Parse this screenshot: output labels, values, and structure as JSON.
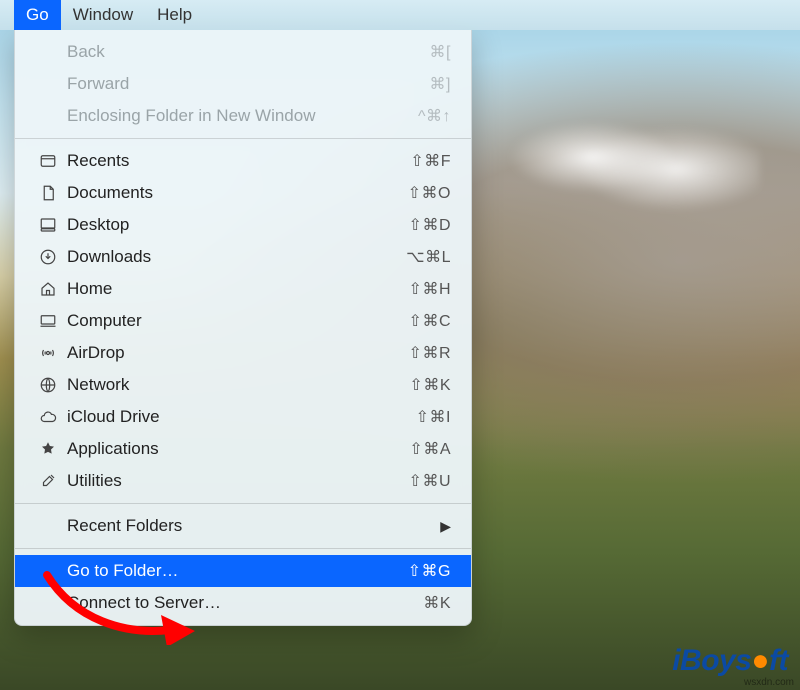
{
  "menubar": {
    "items": [
      {
        "label": "Go",
        "active": true
      },
      {
        "label": "Window",
        "active": false
      },
      {
        "label": "Help",
        "active": false
      }
    ]
  },
  "menu": {
    "section1": [
      {
        "label": "Back",
        "shortcut": "⌘[",
        "disabled": true
      },
      {
        "label": "Forward",
        "shortcut": "⌘]",
        "disabled": true
      },
      {
        "label": "Enclosing Folder in New Window",
        "shortcut": "^⌘↑",
        "disabled": true
      }
    ],
    "section2": [
      {
        "icon": "recents",
        "label": "Recents",
        "shortcut": "⇧⌘F"
      },
      {
        "icon": "documents",
        "label": "Documents",
        "shortcut": "⇧⌘O"
      },
      {
        "icon": "desktop",
        "label": "Desktop",
        "shortcut": "⇧⌘D"
      },
      {
        "icon": "downloads",
        "label": "Downloads",
        "shortcut": "⌥⌘L"
      },
      {
        "icon": "home",
        "label": "Home",
        "shortcut": "⇧⌘H"
      },
      {
        "icon": "computer",
        "label": "Computer",
        "shortcut": "⇧⌘C"
      },
      {
        "icon": "airdrop",
        "label": "AirDrop",
        "shortcut": "⇧⌘R"
      },
      {
        "icon": "network",
        "label": "Network",
        "shortcut": "⇧⌘K"
      },
      {
        "icon": "icloud",
        "label": "iCloud Drive",
        "shortcut": "⇧⌘I"
      },
      {
        "icon": "applications",
        "label": "Applications",
        "shortcut": "⇧⌘A"
      },
      {
        "icon": "utilities",
        "label": "Utilities",
        "shortcut": "⇧⌘U"
      }
    ],
    "section3": [
      {
        "label": "Recent Folders",
        "submenu": true
      }
    ],
    "section4": [
      {
        "label": "Go to Folder…",
        "shortcut": "⇧⌘G",
        "highlight": true
      },
      {
        "label": "Connect to Server…",
        "shortcut": "⌘K"
      }
    ]
  },
  "watermark": {
    "text_pre": "iBoys",
    "text_post": "ft",
    "url": "wsxdn.com"
  },
  "annotation": {
    "arrow_color": "#ff0000"
  }
}
